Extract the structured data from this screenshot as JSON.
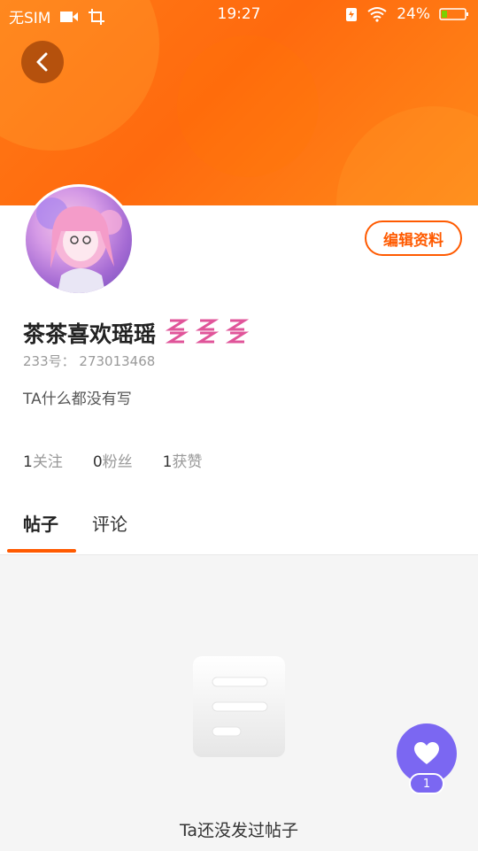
{
  "status_bar": {
    "carrier": "无SIM",
    "time": "19:27",
    "battery": "24%",
    "icons": [
      "video-icon",
      "screenshot-icon",
      "battery-saver-icon",
      "wifi-icon",
      "battery-icon"
    ]
  },
  "profile": {
    "username": "茶茶喜欢瑶瑶",
    "uid_label": "233号：",
    "uid_value": "273013468",
    "bio": "TA什么都没有写",
    "edit_button": "编辑资料"
  },
  "stats": [
    {
      "num": "1",
      "label": "关注"
    },
    {
      "num": "0",
      "label": "粉丝"
    },
    {
      "num": "1",
      "label": "获赞"
    }
  ],
  "tabs": [
    {
      "label": "帖子",
      "active": true
    },
    {
      "label": "评论",
      "active": false
    }
  ],
  "empty_state": {
    "text": "Ta还没发过帖子"
  },
  "floating": {
    "badge": "1"
  },
  "colors": {
    "accent": "#ff5a00",
    "header": "#ff7a16",
    "floating": "#7b67f2"
  }
}
